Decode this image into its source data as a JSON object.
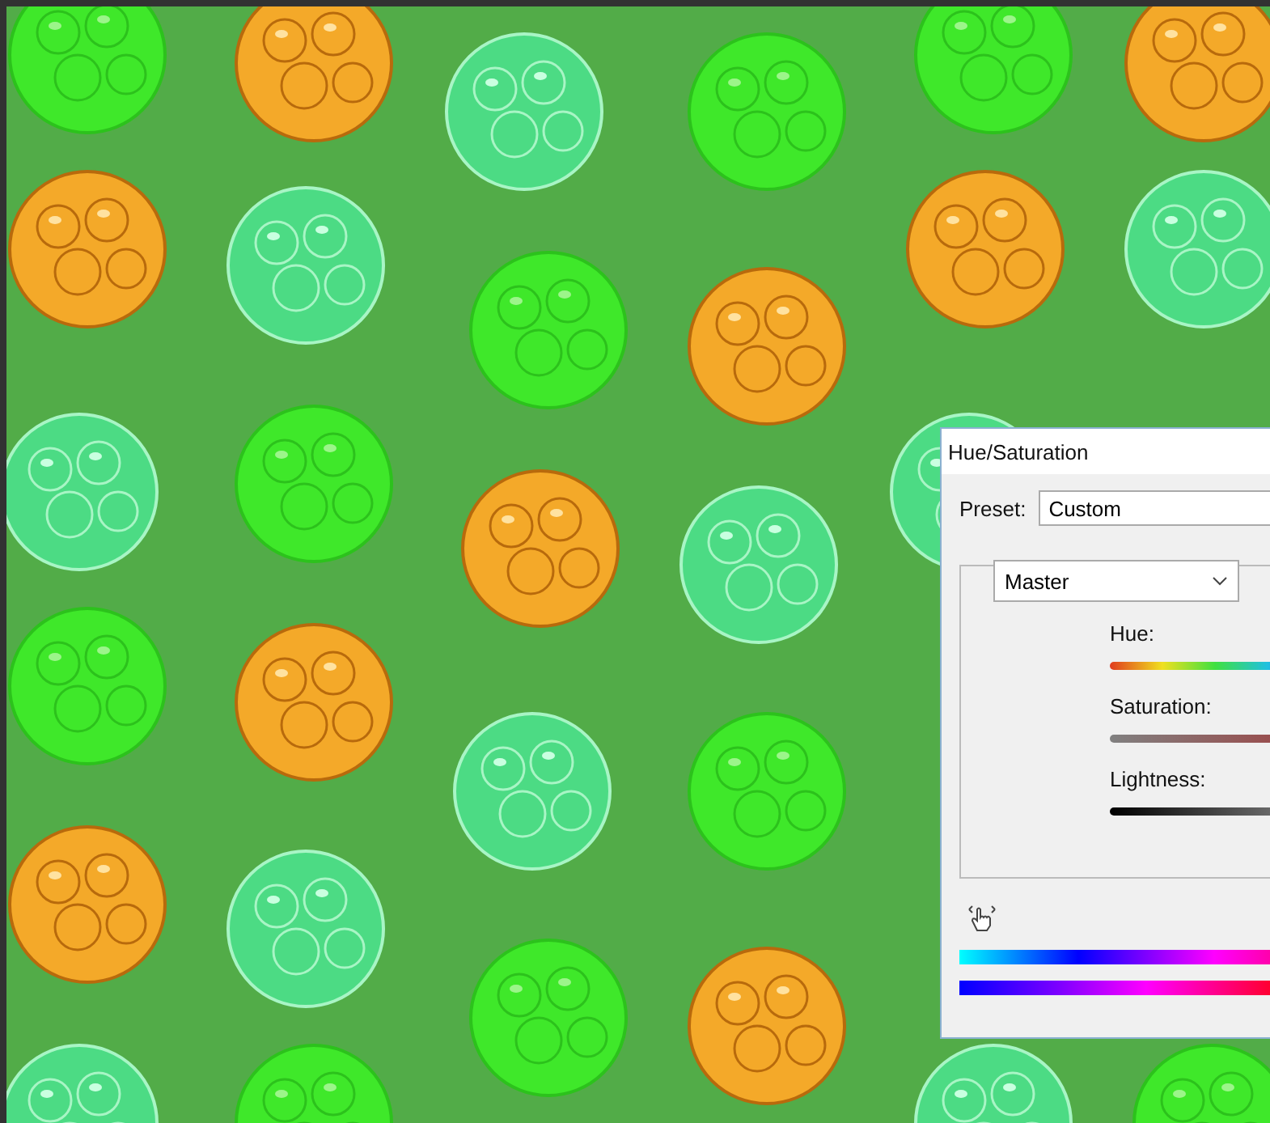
{
  "dialog": {
    "title": "Hue/Saturation",
    "preset": {
      "label": "Preset:",
      "value": "Custom"
    },
    "channel": {
      "value": "Master"
    },
    "sliders": [
      {
        "kind": "hue",
        "label": "Hue:"
      },
      {
        "kind": "saturation",
        "label": "Saturation:"
      },
      {
        "kind": "lightness",
        "label": "Lightness:"
      }
    ]
  }
}
